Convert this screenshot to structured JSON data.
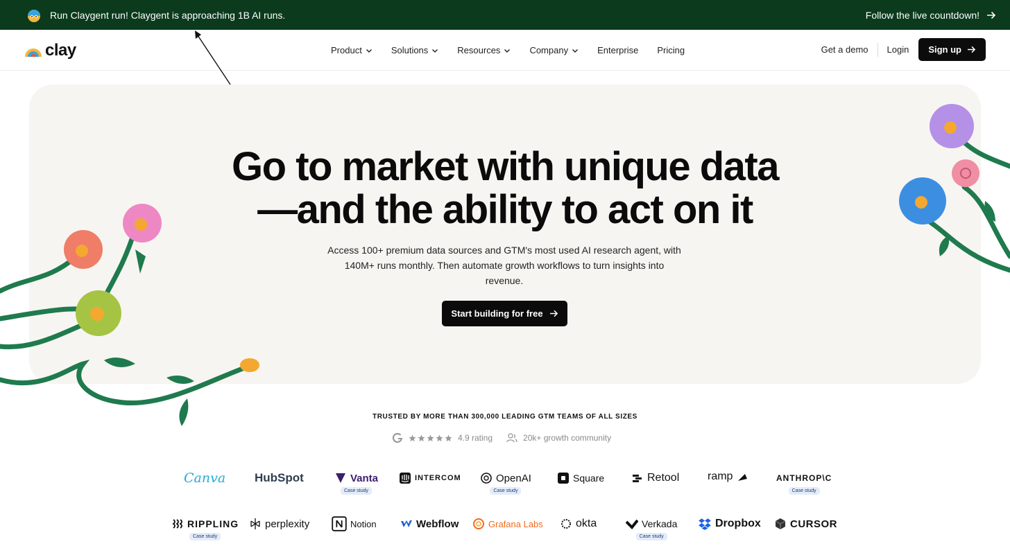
{
  "announcement": {
    "text": "Run Claygent run! Claygent is approaching 1B AI runs.",
    "cta": "Follow the live countdown!"
  },
  "header": {
    "brand": "clay",
    "nav": [
      {
        "label": "Product",
        "dropdown": true
      },
      {
        "label": "Solutions",
        "dropdown": true
      },
      {
        "label": "Resources",
        "dropdown": true
      },
      {
        "label": "Company",
        "dropdown": true
      },
      {
        "label": "Enterprise",
        "dropdown": false
      },
      {
        "label": "Pricing",
        "dropdown": false
      }
    ],
    "get_demo": "Get a demo",
    "login": "Login",
    "signup": "Sign up"
  },
  "hero": {
    "title_line1": "Go to market with unique data",
    "title_line2": "—and the ability to act on it",
    "subtitle": "Access 100+ premium data sources and GTM's most used AI research agent, with 140M+ runs monthly. Then automate growth workflows to turn insights into revenue.",
    "cta": "Start building for free"
  },
  "trust": {
    "heading": "TRUSTED BY MORE THAN 300,000 LEADING GTM TEAMS OF ALL SIZES",
    "rating": "4.9 rating",
    "rating_stars": 5,
    "community": "20k+ growth community"
  },
  "logos": {
    "case_study_label": "Case study",
    "row1": [
      "Canva",
      "HubSpot",
      "Vanta",
      "INTERCOM",
      "OpenAI",
      "Square",
      "Retool",
      "ramp",
      "ANTHROP\\C"
    ],
    "row2": [
      "RIPPLING",
      "perplexity",
      "Notion",
      "Webflow",
      "Grafana Labs",
      "okta",
      "Verkada",
      "Dropbox",
      "CURSOR"
    ]
  },
  "colors": {
    "announcement_bg": "#0b3a1d",
    "hero_bg": "#f7f5f1",
    "button_bg": "#0b0b0b",
    "badge_bg": "#e4ecf8"
  }
}
